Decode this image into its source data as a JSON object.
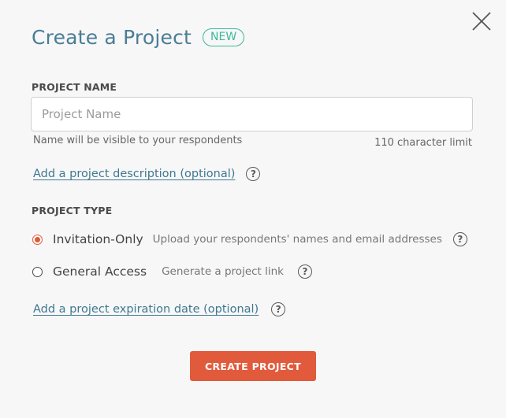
{
  "header": {
    "title": "Create a Project",
    "badge": "NEW"
  },
  "project_name": {
    "label": "PROJECT NAME",
    "placeholder": "Project Name",
    "value": "",
    "hint": "Name will be visible to your respondents",
    "limit_text": "110 character limit"
  },
  "description_link": {
    "label": "Add a project description (optional)",
    "help_icon": "question-circle-icon"
  },
  "project_type": {
    "label": "PROJECT TYPE",
    "options": [
      {
        "label": "Invitation-Only",
        "description": "Upload your respondents' names and email addresses",
        "selected": true
      },
      {
        "label": "General Access",
        "description": "Generate a project link",
        "selected": false
      }
    ]
  },
  "expiration_link": {
    "label": "Add a project expiration date (optional)",
    "help_icon": "question-circle-icon"
  },
  "actions": {
    "create_label": "CREATE PROJECT",
    "close_icon": "close-icon"
  },
  "colors": {
    "title": "#4a7d96",
    "badge": "#3bb89a",
    "accent": "#e05a3b",
    "link": "#3f7891"
  }
}
